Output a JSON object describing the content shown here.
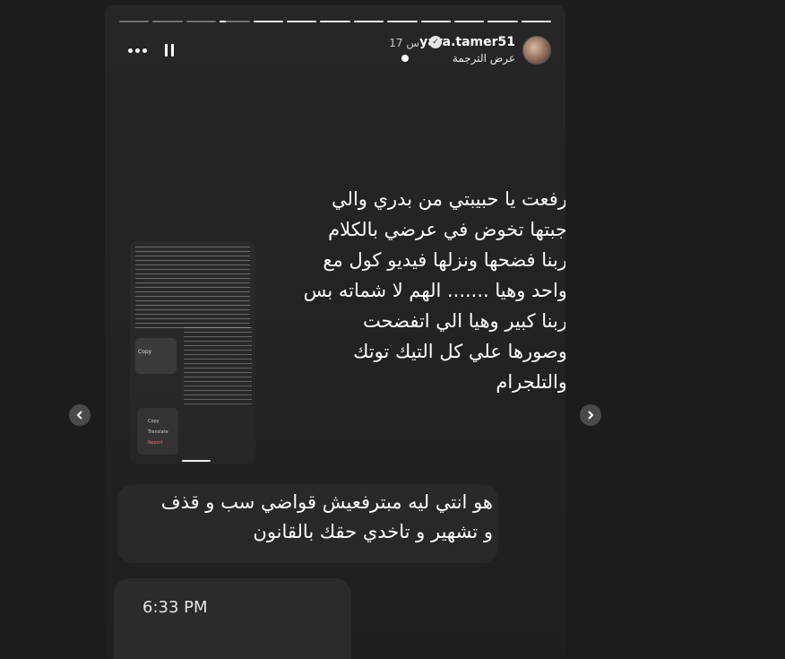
{
  "story": {
    "progress": {
      "total": 13,
      "current": 9
    },
    "header": {
      "username": "yara.tamer51",
      "time": "17 س",
      "translate_label": "عرض الترجمة"
    },
    "caption": [
      "رفعت يا حبيبتي من بدري والي",
      "جبتها تخوض في عرضي بالكلام",
      "ربنا فضحها ونزلها فيديو كول مع",
      "واحد وهيا ....... الهم لا شماته بس",
      "ربنا كبير وهيا الي اتفضحت",
      "وصورها علي كل التيك توتك",
      "والتلجرام"
    ],
    "thumbnail": {
      "menu_copy": "Copy",
      "menu_items": [
        "Copy",
        "Translate",
        "Report"
      ]
    },
    "reply": [
      "هو انتي ليه مبترفعيش قواضي سب و قذف",
      "و تشهير و تاخدي حقك بالقانون"
    ],
    "card_time": "6:33 PM"
  },
  "colors": {
    "background": "#1c1c1c",
    "story_bg": "#262626",
    "text": "#ffffff",
    "report": "#ff6a6a"
  }
}
